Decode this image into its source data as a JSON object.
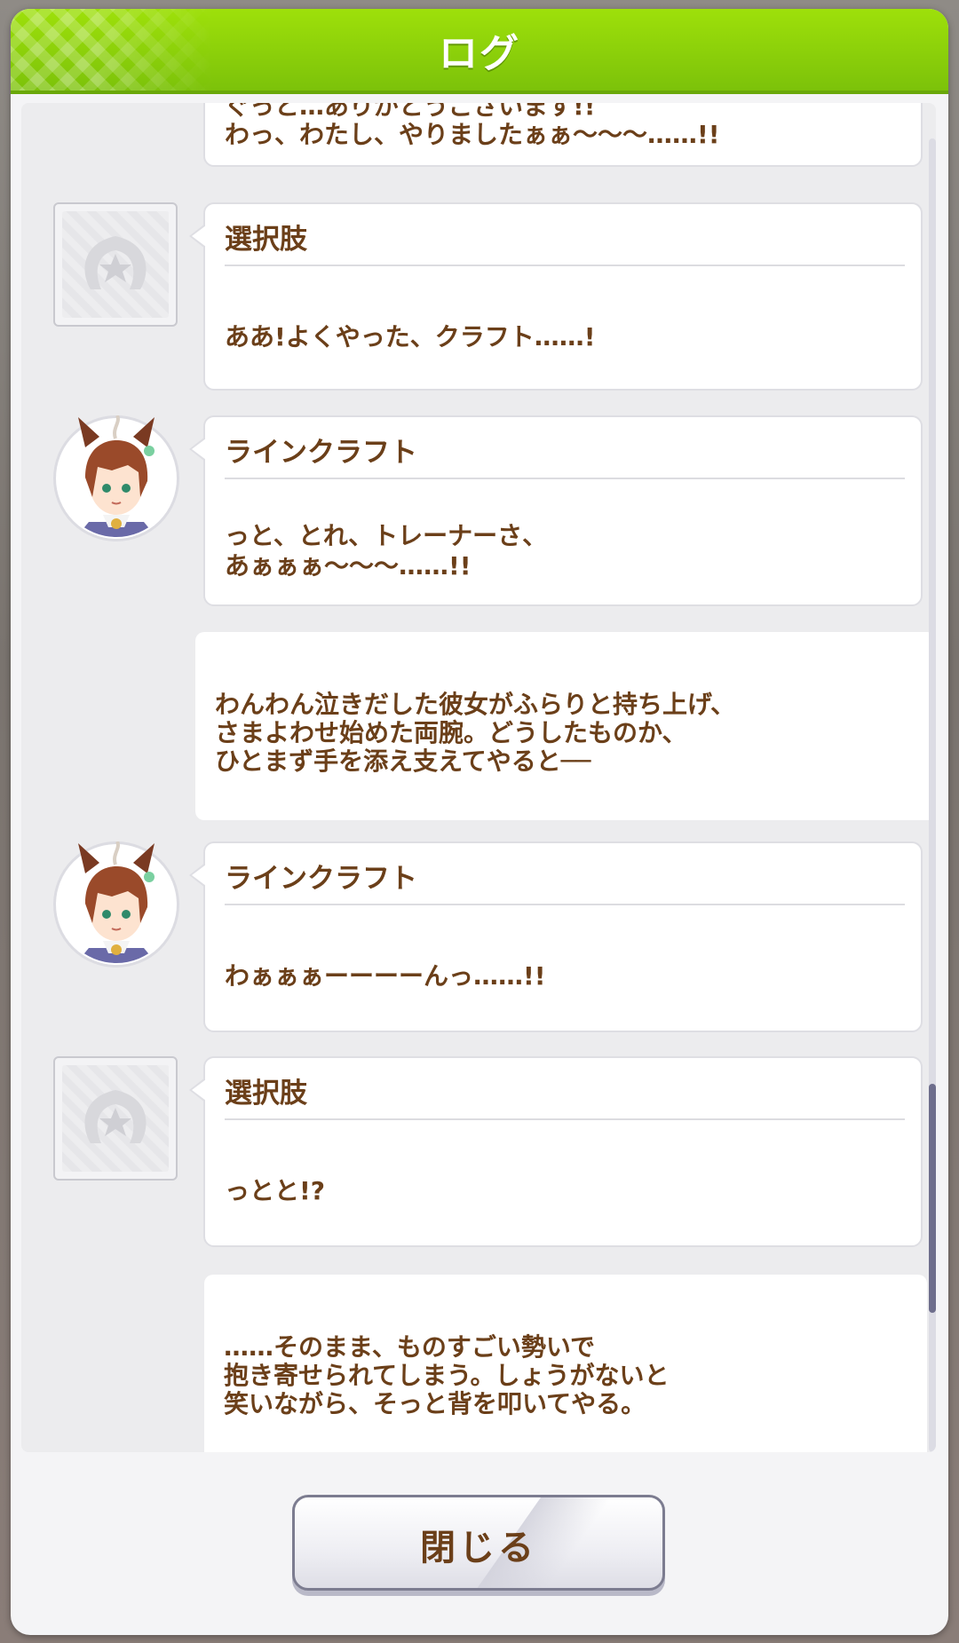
{
  "header": {
    "title": "ログ"
  },
  "entries": [
    {
      "type": "dialogue",
      "speaker": "",
      "lines": [
        "ぐっと…ありがとうございます!!",
        "わっ、わたし、やりましたぁぁ～～～……!!"
      ]
    },
    {
      "type": "dialogue",
      "speaker": "選択肢",
      "lines": [
        "ああ!よくやった、クラフト……!"
      ]
    },
    {
      "type": "dialogue",
      "speaker": "ラインクラフト",
      "lines": [
        "っと、とれ、トレーナーさ、",
        "あぁぁぁ～～～……!!"
      ]
    },
    {
      "type": "narration",
      "lines": [
        "わんわん泣きだした彼女がふらりと持ち上げ、",
        "さまよわせ始めた両腕。どうしたものか、",
        "ひとまず手を添え支えてやると──"
      ]
    },
    {
      "type": "dialogue",
      "speaker": "ラインクラフト",
      "lines": [
        "わぁぁぁーーーーんっ……!!"
      ]
    },
    {
      "type": "dialogue",
      "speaker": "選択肢",
      "lines": [
        "っとと!?"
      ]
    },
    {
      "type": "narration",
      "lines": [
        "……そのまま、ものすごい勢いで",
        "抱き寄せられてしまう。しょうがないと",
        "笑いながら、そっと背を叩いてやる。"
      ]
    }
  ],
  "footer": {
    "close_label": "閉じる"
  },
  "icons": {
    "choice_avatar": "horseshoe-star-icon",
    "character_avatar": "character-portrait"
  },
  "colors": {
    "header_green": "#8fd20a",
    "text_brown": "#6b3f19",
    "scroll_thumb": "#6e6e8c"
  }
}
